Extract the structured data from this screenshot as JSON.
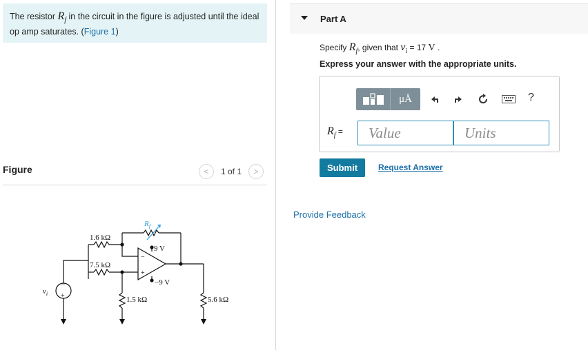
{
  "problem": {
    "text_before": "The resistor ",
    "variable": "R",
    "variable_sub": "f",
    "text_after": " in the circuit in the figure is adjusted until the ideal op amp saturates. (",
    "figure_link": "Figure 1",
    "text_end": ")"
  },
  "figure": {
    "heading": "Figure",
    "page_indicator": "1 of 1",
    "prev_glyph": "<",
    "next_glyph": ">"
  },
  "circuit": {
    "r_top_left": "1.6 kΩ",
    "r_mid_left": "7.5 kΩ",
    "r_feedback": "R",
    "r_feedback_sub": "f",
    "supply_pos": "9 V",
    "supply_neg": "−9 V",
    "r_bottom_mid": "1.5 kΩ",
    "r_load": "5.6 kΩ",
    "source_label": "v",
    "source_label_sub": "i",
    "plus_sign": "+",
    "minus_sign": "−"
  },
  "part": {
    "title": "Part A"
  },
  "question": {
    "prefix": "Specify ",
    "var": "R",
    "var_sub": "f",
    "middle": ", given that ",
    "given_var": "v",
    "given_sub": "i",
    "equals": " = 17 ",
    "unit": "V",
    "suffix": " .",
    "instruction": "Express your answer with the appropriate units."
  },
  "answer": {
    "label_var": "R",
    "label_sub": "f",
    "label_equals": " =",
    "value_placeholder": "Value",
    "units_placeholder": "Units",
    "units_button": "μÅ",
    "help": "?"
  },
  "actions": {
    "submit": "Submit",
    "request_answer": "Request Answer",
    "provide_feedback": "Provide Feedback"
  },
  "colors": {
    "problem_bg": "#e4f4f6",
    "link": "#1a6fa8",
    "submit_bg": "#137aa0",
    "toolbar_bg": "#7e8f99",
    "field_border": "#2b8fb5"
  }
}
